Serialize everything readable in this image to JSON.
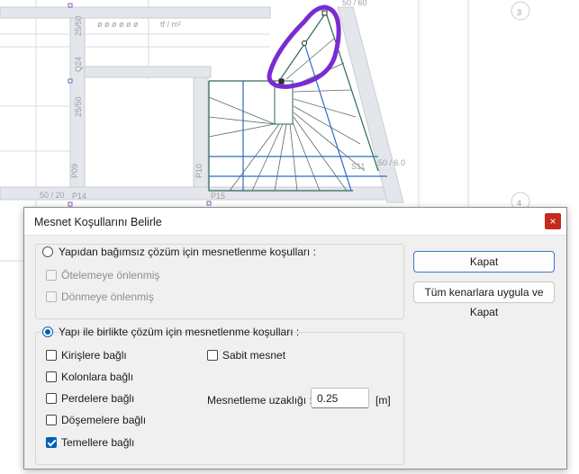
{
  "drawing": {
    "labels": {
      "axis_top": "3",
      "axis_bottom": "4",
      "p09": "P09",
      "p10": "P10",
      "p14": "P14",
      "p15": "P15",
      "s11": "S11",
      "dim_2550": "25/50",
      "dim_2550b": "25/50",
      "dim_qa": "Q24",
      "load_1": "ø ø ø ø ø ø",
      "load_2": "tf / m²",
      "dim_5060": "50 / 60",
      "dim_5060b": "50 / 6.0",
      "dim_bottom": "50 / 20"
    },
    "colors": {
      "highlight": "#7a2bd1",
      "stair_line": "#2d6a5e",
      "blue_line": "#2b6cc4"
    }
  },
  "dialog": {
    "title": "Mesnet Koşullarını Belirle",
    "close_label": "×",
    "group1": {
      "radio_label": "Yapıdan bağımsız çözüm için mesnetlenme koşulları  :",
      "selected": false,
      "options": [
        {
          "label": "Ötelemeye önlenmiş",
          "checked": false,
          "disabled": true
        },
        {
          "label": "Dönmeye önlenmiş",
          "checked": false,
          "disabled": true
        }
      ]
    },
    "group2": {
      "radio_label": "Yapı ile birlikte çözüm için mesnetlenme koşulları  :",
      "selected": true,
      "left_options": [
        {
          "label": "Kirişlere bağlı",
          "checked": false
        },
        {
          "label": "Kolonlara bağlı",
          "checked": false
        },
        {
          "label": "Perdelere bağlı",
          "checked": false
        },
        {
          "label": "Döşemelere bağlı",
          "checked": false
        },
        {
          "label": "Temellere bağlı",
          "checked": true
        }
      ],
      "fixed_support": {
        "label": "Sabit mesnet",
        "checked": false
      },
      "support_distance": {
        "label": "Mesnetleme uzaklığı  :",
        "value": "0.25",
        "unit": "[m]"
      }
    },
    "buttons": {
      "close": "Kapat",
      "apply_all": "Tüm kenarlara uygula ve Kapat"
    }
  }
}
